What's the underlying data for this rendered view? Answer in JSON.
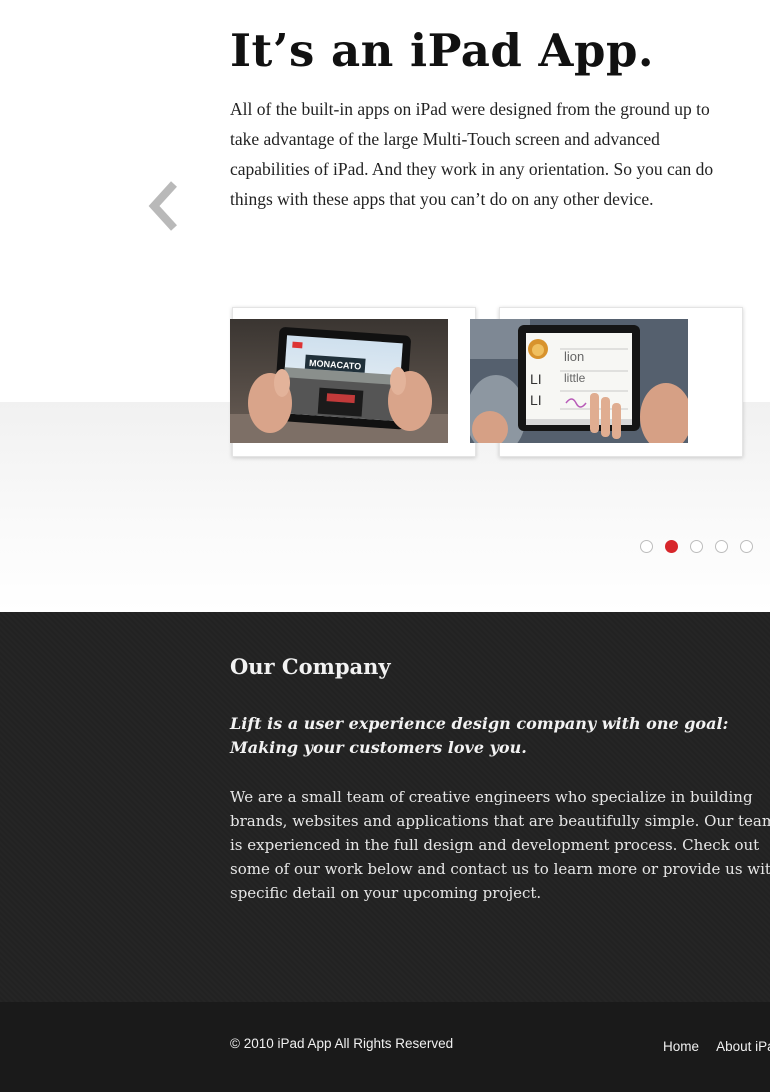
{
  "hero": {
    "title": "It’s an iPad App.",
    "description": "All of the built-in apps on iPad were designed from the ground up to take advantage of the large Multi-Touch screen and advanced capabilities of iPad. And they work in any orientation. So you can do things with these apps that you can’t do on any other device.",
    "prev_icon": "chevron-left-icon",
    "screenshots": [
      {
        "sign_text": "MONACATO"
      },
      {
        "lines": [
          "lion",
          "little",
          "LI",
          "LI"
        ]
      }
    ],
    "pagination": {
      "count": 5,
      "active_index": 1,
      "active_color": "#d7262b"
    }
  },
  "company": {
    "title": "Our Company",
    "lead": "Lift is a user experience design company with one goal: Making your customers love you.",
    "body": "We are a small team of creative engineers who specialize in building brands, websites and applications that are beautifully simple. Our team is experienced in the full design and development process. Check out some of our work below and contact us to learn more or provide us with specific detail on your upcoming project."
  },
  "footer": {
    "copyright": "© 2010 iPad App All Rights Reserved",
    "links": [
      "Home",
      "About iPad"
    ]
  },
  "colors": {
    "accent": "#d7262b",
    "dark_section": "#222222",
    "footer": "#1a1a1a"
  }
}
